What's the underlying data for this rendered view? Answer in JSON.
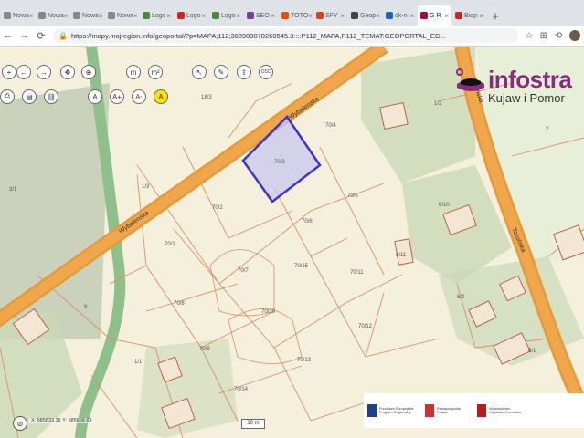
{
  "browser": {
    "tabs": [
      {
        "label": "Nowa",
        "color": "#888"
      },
      {
        "label": "Nowa",
        "color": "#888"
      },
      {
        "label": "Nowa",
        "color": "#888"
      },
      {
        "label": "Nowa",
        "color": "#888"
      },
      {
        "label": "Logo",
        "color": "#4a8a3a"
      },
      {
        "label": "Logo",
        "color": "#c62828"
      },
      {
        "label": "Logo",
        "color": "#4a8a3a"
      },
      {
        "label": "SEO",
        "color": "#7b3fa0"
      },
      {
        "label": "TOTO",
        "color": "#e65100"
      },
      {
        "label": "SFY",
        "color": "#d84315"
      },
      {
        "label": "Geop",
        "color": "#444"
      },
      {
        "label": "ok-n",
        "color": "#1565c0"
      },
      {
        "label": "G R",
        "color": "#b0004d",
        "active": true
      },
      {
        "label": "Biop",
        "color": "#c62828"
      }
    ],
    "new_tab": "+",
    "url": "https://mapy.mojregion.info/geoportal/?p=MAPA;112;368903070260545.3::::P112_MAPA,P112_TEMAT:GEOPORTAL_EG..."
  },
  "map": {
    "logo": {
      "title": "infostra",
      "subtitle": "Kujaw i Pomor"
    },
    "roads": {
      "wybalenska_1": "Wybalenska",
      "wybalenska_2": "Wybalenska",
      "torunska_1": "Toruńska",
      "torunska_2": "Toruńska"
    },
    "parcels": {
      "p1": "70/3",
      "p2": "70/4",
      "p3": "70/5",
      "p4": "70/2",
      "p5": "70/1",
      "p6": "70/6",
      "p7": "70/7",
      "p8": "70/8",
      "p9": "70/9",
      "p10": "70/10",
      "p11": "70/11",
      "p12": "70/12",
      "p13": "70/13",
      "p14": "70/14",
      "p15": "70/15",
      "p16": "18/3",
      "p17": "1/2",
      "p18": "6/11",
      "p19": "6/10",
      "p20": "1/3",
      "p21": "9",
      "p22": "2",
      "p23": "6/2",
      "p24": "1/1",
      "p25": "3/1",
      "p26": "6/1"
    },
    "coordinates": "X: 585833.36  Y: 585666.63",
    "scale": "10 m",
    "partners": [
      {
        "label": "Fundusze Europejskie Program Regionalny",
        "color": "#1f3f8f"
      },
      {
        "label": "Rzeczpospolita Polska",
        "color": "#d32f2f"
      },
      {
        "label": "Województwo Kujawsko-Pomorskie",
        "color": "#b71c1c"
      }
    ]
  },
  "toolbar": {
    "zoom_in": "+",
    "zoom_out": "−",
    "pan": "✥",
    "select": "↖",
    "fullscreen": "⊕",
    "measure_length": "m",
    "measure_area": "m²",
    "edit": "✎",
    "export": "⇪",
    "osc": "OSC",
    "print": "⎙",
    "save": "▤",
    "link": "⛓",
    "text_normal": "A",
    "text_plus": "A+",
    "text_minus": "A-",
    "text_contrast": "A"
  }
}
